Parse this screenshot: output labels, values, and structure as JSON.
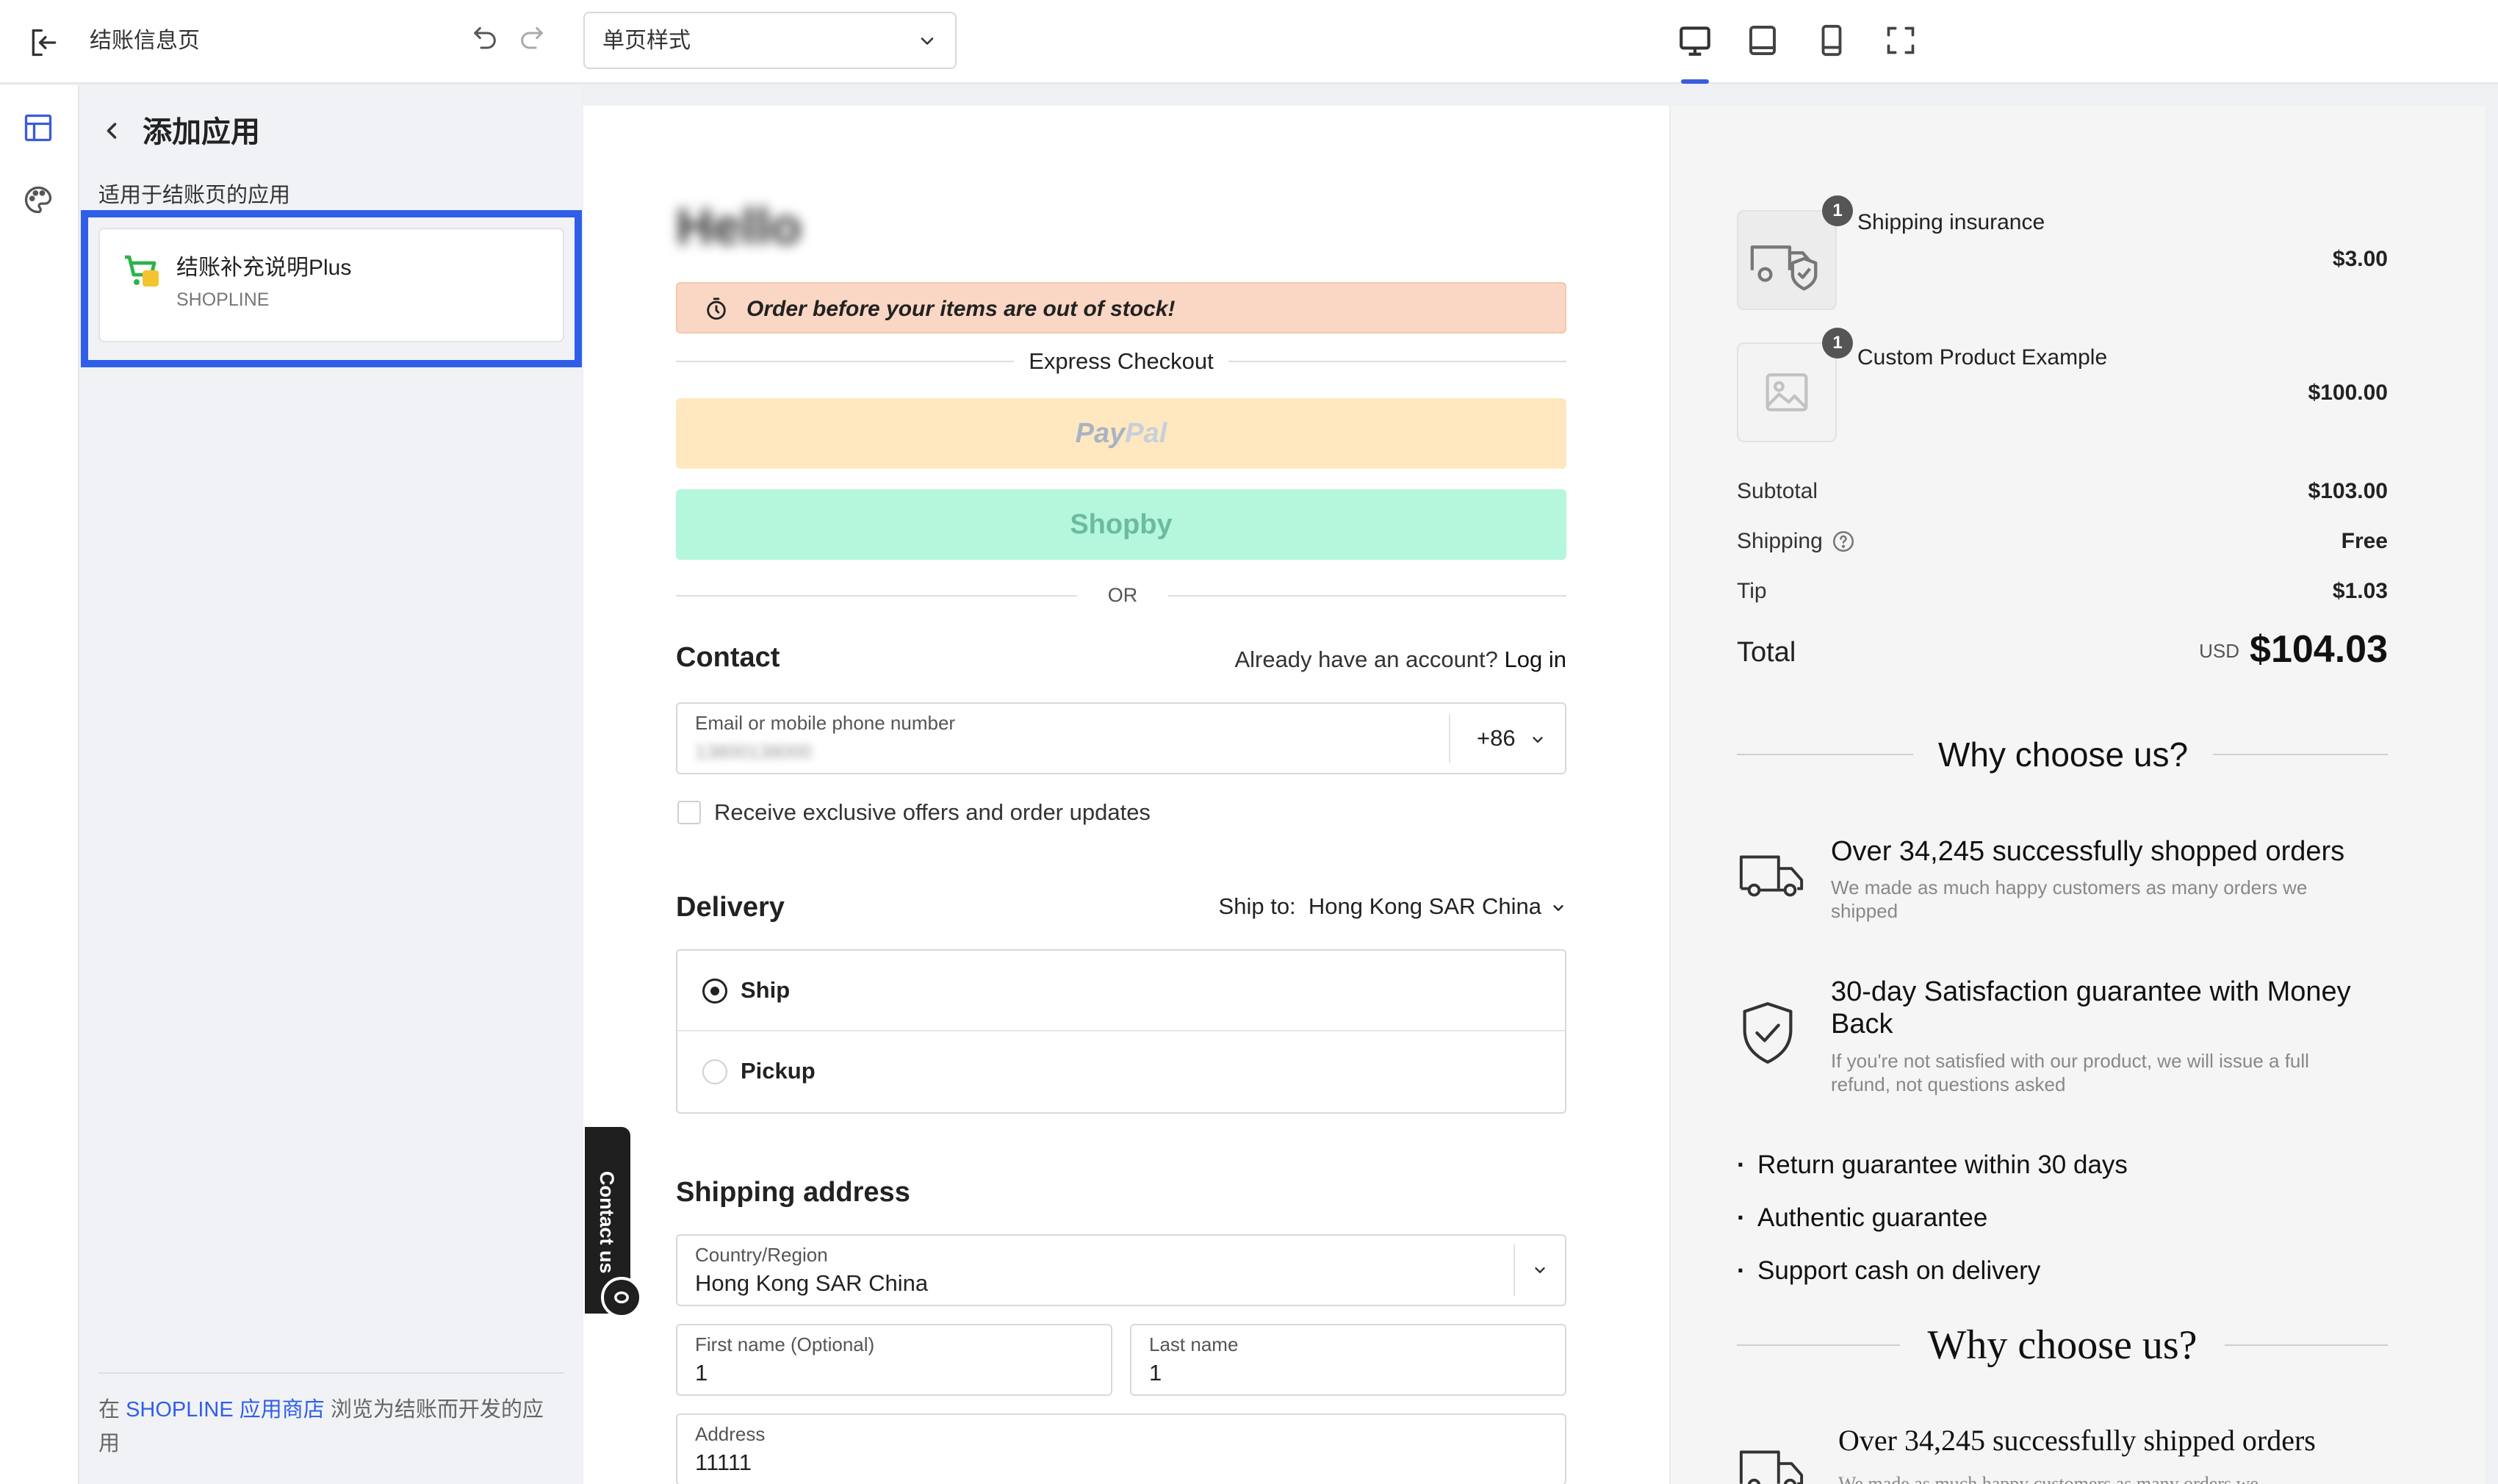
{
  "topbar": {
    "page_name": "结账信息页",
    "style_select": "单页样式",
    "devices": [
      "desktop-icon",
      "tablet-icon",
      "mobile-icon",
      "fullscreen-icon"
    ],
    "accent": "#3b5bdb"
  },
  "panel": {
    "title": "添加应用",
    "section_label": "适用于结账页的应用",
    "app": {
      "name": "结账补充说明Plus",
      "vendor": "SHOPLINE"
    },
    "footer_prefix": "在 ",
    "footer_link": "SHOPLINE 应用商店",
    "footer_suffix": " 浏览为结账而开发的应用",
    "highlight_color": "#2f5fe8"
  },
  "checkout": {
    "store_logo": "Hello",
    "stock_banner": "Order before your items are out of stock!",
    "express_label": "Express Checkout",
    "paypal_label_a": "Pay",
    "paypal_label_b": "Pal",
    "shopby_label": "Shopby",
    "or_label": "OR",
    "contact": {
      "heading": "Contact",
      "login_prompt": "Already have an account?",
      "login_link": "Log in",
      "email_label": "Email or mobile phone number",
      "email_value": "13800138000",
      "phone_code": "+86",
      "offers_label": "Receive exclusive offers and order updates"
    },
    "delivery": {
      "heading": "Delivery",
      "ship_to_label": "Ship to:",
      "ship_to_value": "Hong Kong SAR China",
      "options": [
        "Ship",
        "Pickup"
      ],
      "selected": "Ship"
    },
    "shipping_address": {
      "heading": "Shipping address",
      "country_label": "Country/Region",
      "country_value": "Hong Kong SAR China",
      "first_name_label": "First name (Optional)",
      "first_name_value": "1",
      "last_name_label": "Last name",
      "last_name_value": "1",
      "address_label": "Address",
      "address_value": "11111"
    },
    "contact_tab": "Contact us"
  },
  "summary": {
    "items": [
      {
        "name": "Shipping insurance",
        "qty": "1",
        "price": "$3.00",
        "icon": "truck-shield-icon"
      },
      {
        "name": "Custom Product Example",
        "qty": "1",
        "price": "$100.00",
        "icon": "image-placeholder-icon"
      }
    ],
    "subtotal_label": "Subtotal",
    "subtotal": "$103.00",
    "shipping_label": "Shipping",
    "shipping": "Free",
    "tip_label": "Tip",
    "tip": "$1.03",
    "total_label": "Total",
    "currency": "USD",
    "total": "$104.03",
    "why_title": "Why choose us?",
    "features": [
      {
        "title": "Over 34,245 successfully shopped orders",
        "desc": "We made as much happy customers as many orders we shipped"
      },
      {
        "title": "30-day Satisfaction guarantee with Money Back",
        "desc": "If you're not satisfied with our product, we will issue a full refund, not questions asked"
      }
    ],
    "bullets": [
      "Return guarantee within 30 days",
      "Authentic guarantee",
      "Support cash on delivery"
    ],
    "why_title_2": "Why choose us?",
    "feature_3": {
      "title": "Over 34,245 successfully shipped orders",
      "desc": "We made as much happy customers as many orders we"
    }
  }
}
